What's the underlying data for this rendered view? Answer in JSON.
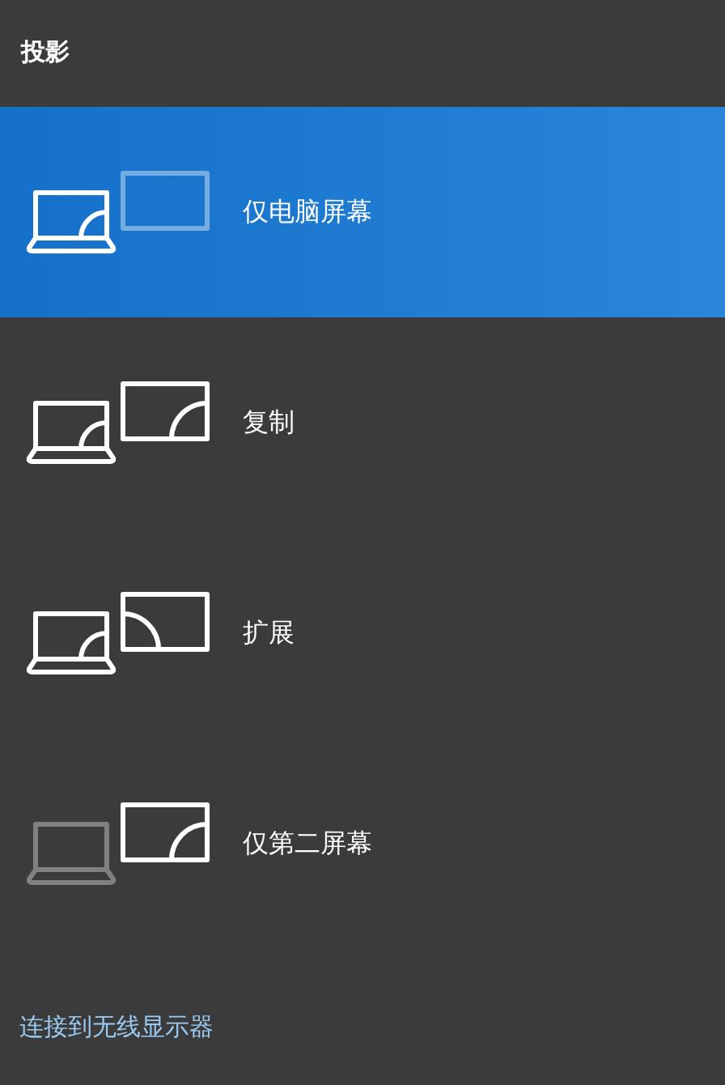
{
  "panel": {
    "title": "投影"
  },
  "options": [
    {
      "label": "仅电脑屏幕",
      "kind": "pc_only",
      "selected": true
    },
    {
      "label": "复制",
      "kind": "duplicate",
      "selected": false
    },
    {
      "label": "扩展",
      "kind": "extend",
      "selected": false
    },
    {
      "label": "仅第二屏幕",
      "kind": "second_only",
      "selected": false
    }
  ],
  "link": "连接到无线显示器"
}
